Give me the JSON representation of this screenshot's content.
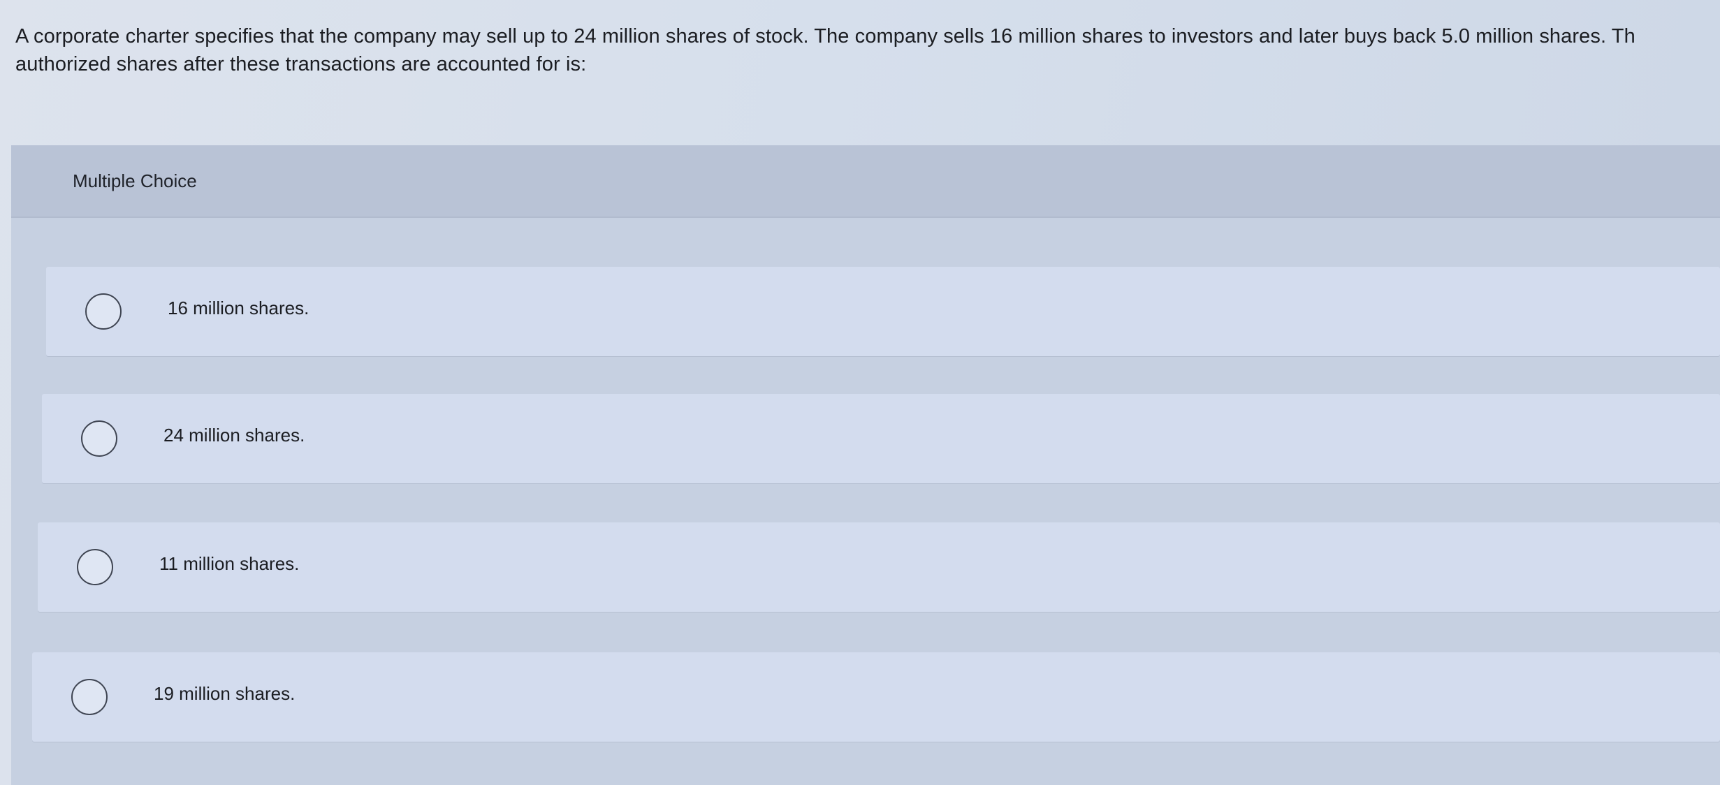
{
  "question": {
    "line1": "A corporate charter specifies that the company may sell up to 24 million shares of stock. The company sells 16 million shares to investors and later buys back 5.0 million shares. Th",
    "line2": "authorized shares after these transactions are accounted for is:"
  },
  "multiple_choice": {
    "header": "Multiple Choice",
    "options": [
      {
        "label": "16 million shares."
      },
      {
        "label": "24 million shares."
      },
      {
        "label": "11 million shares."
      },
      {
        "label": "19 million shares."
      }
    ]
  }
}
